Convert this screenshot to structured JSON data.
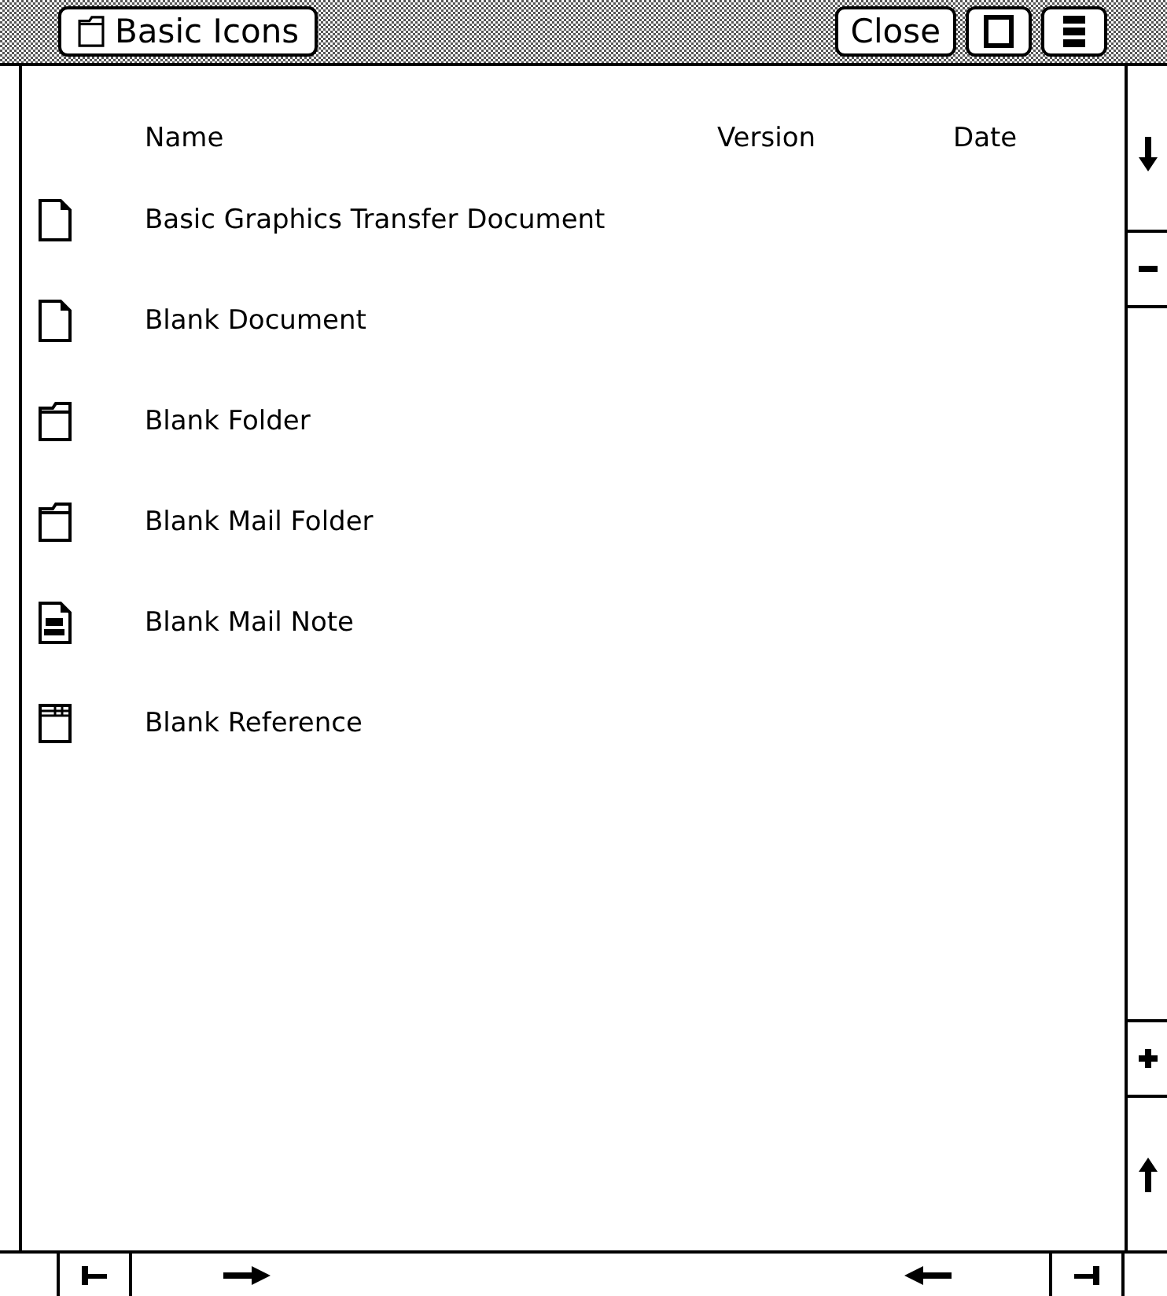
{
  "window": {
    "title": "Basic Icons",
    "close_button": "Close"
  },
  "table": {
    "columns": [
      "Name",
      "Version",
      "Date"
    ],
    "rows": [
      {
        "kind": "document",
        "name": "Basic Graphics Transfer Document"
      },
      {
        "kind": "document",
        "name": "Blank Document"
      },
      {
        "kind": "folder",
        "name": "Blank Folder"
      },
      {
        "kind": "folder",
        "name": "Blank Mail Folder"
      },
      {
        "kind": "mailnote",
        "name": "Blank Mail Note"
      },
      {
        "kind": "reference",
        "name": "Blank Reference"
      }
    ]
  }
}
